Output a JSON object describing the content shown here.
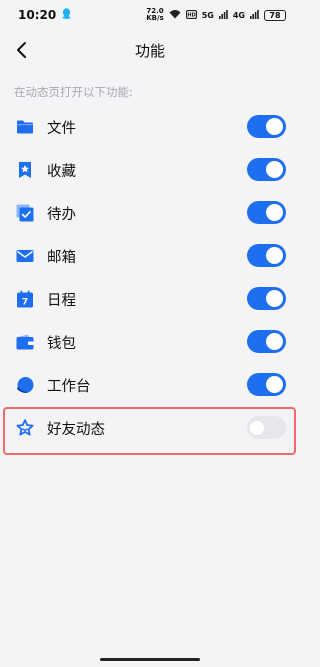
{
  "status_bar": {
    "time": "10:20",
    "net_speed_value": "72.0",
    "net_speed_unit": "KB/s",
    "signal_1": "5G",
    "signal_2": "4G",
    "battery": "78"
  },
  "header": {
    "title": "功能",
    "back_icon": "chevron-left-icon"
  },
  "section_hint": "在动态页打开以下功能:",
  "items": [
    {
      "label": "文件",
      "icon": "folder-icon",
      "enabled": true
    },
    {
      "label": "收藏",
      "icon": "bookmark-star-icon",
      "enabled": true
    },
    {
      "label": "待办",
      "icon": "todo-check-icon",
      "enabled": true
    },
    {
      "label": "邮箱",
      "icon": "mail-icon",
      "enabled": true
    },
    {
      "label": "日程",
      "icon": "calendar-icon",
      "enabled": true
    },
    {
      "label": "钱包",
      "icon": "wallet-icon",
      "enabled": true
    },
    {
      "label": "工作台",
      "icon": "workbench-icon",
      "enabled": true
    },
    {
      "label": "好友动态",
      "icon": "friend-feed-star-icon",
      "enabled": false
    }
  ],
  "colors": {
    "accent": "#1e6ef0",
    "highlight_border": "#f26b6b",
    "background": "#f4f4f6",
    "hint_text": "#a7a9b0"
  }
}
